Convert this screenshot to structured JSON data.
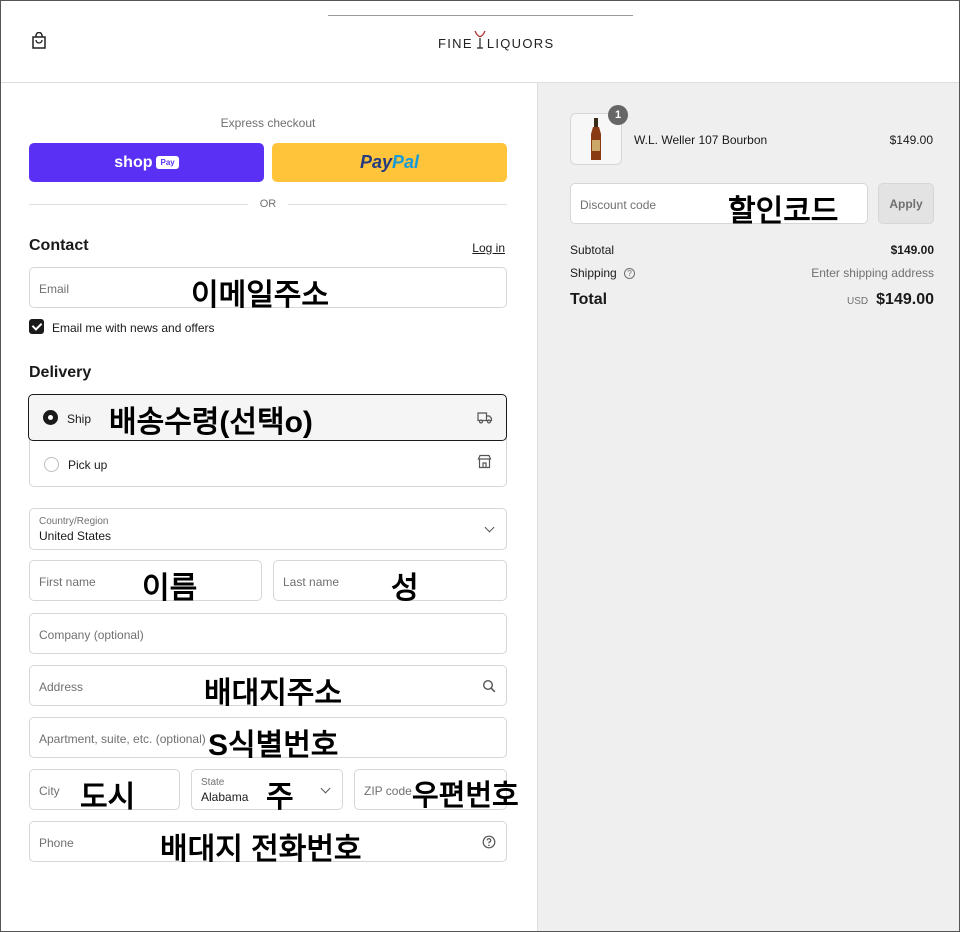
{
  "header": {
    "logo_left": "FINE",
    "logo_right": "LIQUORS"
  },
  "express": {
    "label": "Express checkout",
    "shop_pay_label": "shop",
    "shop_pay_badge": "Pay",
    "paypal_part1": "Pay",
    "paypal_part2": "Pal",
    "or_label": "OR"
  },
  "contact": {
    "title": "Contact",
    "login_link": "Log in",
    "email_placeholder": "Email",
    "email_overlay": "이메일주소",
    "newsletter_label": "Email me with news and offers",
    "newsletter_checked": true
  },
  "delivery": {
    "title": "Delivery",
    "options": [
      {
        "label": "Ship",
        "selected": true,
        "overlay": "배송수령(선택o)"
      },
      {
        "label": "Pick up",
        "selected": false
      }
    ],
    "country_label": "Country/Region",
    "country_value": "United States",
    "first_name_placeholder": "First name",
    "first_name_overlay": "이름",
    "last_name_placeholder": "Last name",
    "last_name_overlay": "성",
    "company_placeholder": "Company (optional)",
    "address_placeholder": "Address",
    "address_overlay": "배대지주소",
    "apartment_placeholder": "Apartment, suite, etc. (optional)",
    "apartment_overlay": "S식별번호",
    "city_placeholder": "City",
    "city_overlay": "도시",
    "state_label": "State",
    "state_value": "Alabama",
    "state_overlay": "주",
    "zip_placeholder": "ZIP code",
    "zip_overlay": "우편번호",
    "phone_placeholder": "Phone",
    "phone_overlay": "배대지 전화번호"
  },
  "summary": {
    "item_qty": "1",
    "item_name": "W.L. Weller 107 Bourbon",
    "item_price": "$149.00",
    "discount_placeholder": "Discount code",
    "discount_overlay": "할인코드",
    "apply_label": "Apply",
    "subtotal_label": "Subtotal",
    "subtotal_value": "$149.00",
    "shipping_label": "Shipping",
    "shipping_value": "Enter shipping address",
    "total_label": "Total",
    "total_currency": "USD",
    "total_value": "$149.00"
  },
  "colors": {
    "shop_pay": "#5a31f4",
    "paypal": "#ffc439",
    "summary_bg": "#efefef"
  }
}
